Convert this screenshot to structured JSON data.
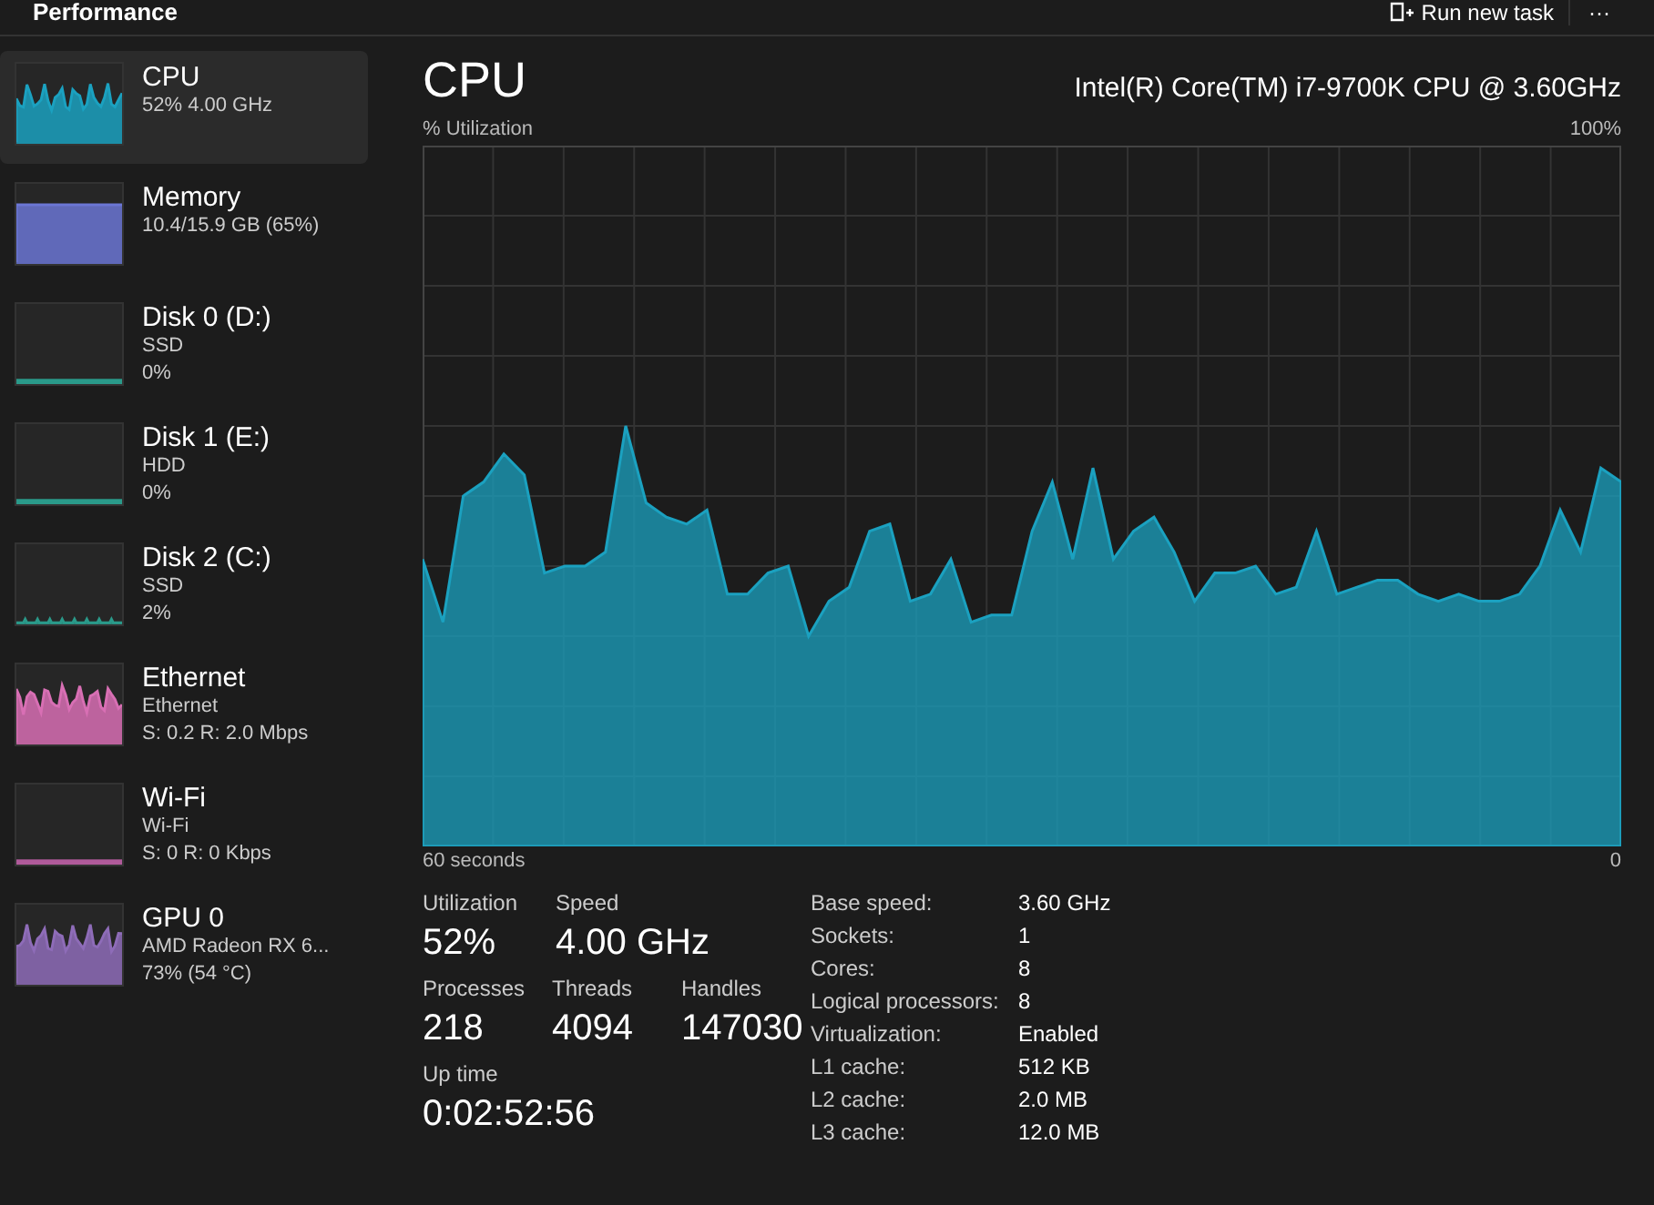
{
  "header": {
    "title": "Performance",
    "run_task": "Run new task",
    "more": "···"
  },
  "sidebar": {
    "items": [
      {
        "name": "CPU",
        "line1": "52% 4.00 GHz",
        "color": "#1ba1c0",
        "selected": true,
        "kind": "wave"
      },
      {
        "name": "Memory",
        "line1": "10.4/15.9 GB (65%)",
        "color": "#6b76d4",
        "selected": false,
        "kind": "block"
      },
      {
        "name": "Disk 0 (D:)",
        "line1": "SSD",
        "line2": "0%",
        "color": "#2a9a8a",
        "selected": false,
        "kind": "flat"
      },
      {
        "name": "Disk 1 (E:)",
        "line1": "HDD",
        "line2": "0%",
        "color": "#2a9a8a",
        "selected": false,
        "kind": "flat"
      },
      {
        "name": "Disk 2 (C:)",
        "line1": "SSD",
        "line2": "2%",
        "color": "#2a9a8a",
        "selected": false,
        "kind": "ticks"
      },
      {
        "name": "Ethernet",
        "line1": "Ethernet",
        "line2": "S: 0.2 R: 2.0 Mbps",
        "color": "#d86fb4",
        "selected": false,
        "kind": "wave"
      },
      {
        "name": "Wi-Fi",
        "line1": "Wi-Fi",
        "line2": "S: 0 R: 0 Kbps",
        "color": "#b05a9a",
        "selected": false,
        "kind": "flat"
      },
      {
        "name": "GPU 0",
        "line1": "AMD Radeon RX 6...",
        "line2": "73% (54 °C)",
        "color": "#8e6cb8",
        "selected": false,
        "kind": "wave"
      }
    ]
  },
  "main": {
    "title": "CPU",
    "model": "Intel(R) Core(TM) i7-9700K CPU @ 3.60GHz",
    "graph": {
      "ylabel": "% Utilization",
      "top_label": "100%",
      "start_label": "60 seconds",
      "end_label": "0"
    },
    "stats": [
      {
        "label": "Utilization",
        "value": "52%"
      },
      {
        "label": "Speed",
        "value": "4.00 GHz"
      },
      {
        "label": "Processes",
        "value": "218"
      },
      {
        "label": "Threads",
        "value": "4094"
      },
      {
        "label": "Handles",
        "value": "147030"
      },
      {
        "label": "Up time",
        "value": "0:02:52:56"
      }
    ],
    "details": [
      {
        "label": "Base speed:",
        "value": "3.60 GHz"
      },
      {
        "label": "Sockets:",
        "value": "1"
      },
      {
        "label": "Cores:",
        "value": "8"
      },
      {
        "label": "Logical processors:",
        "value": "8"
      },
      {
        "label": "Virtualization:",
        "value": "Enabled"
      },
      {
        "label": "L1 cache:",
        "value": "512 KB"
      },
      {
        "label": "L2 cache:",
        "value": "2.0 MB"
      },
      {
        "label": "L3 cache:",
        "value": "12.0 MB"
      }
    ]
  }
}
